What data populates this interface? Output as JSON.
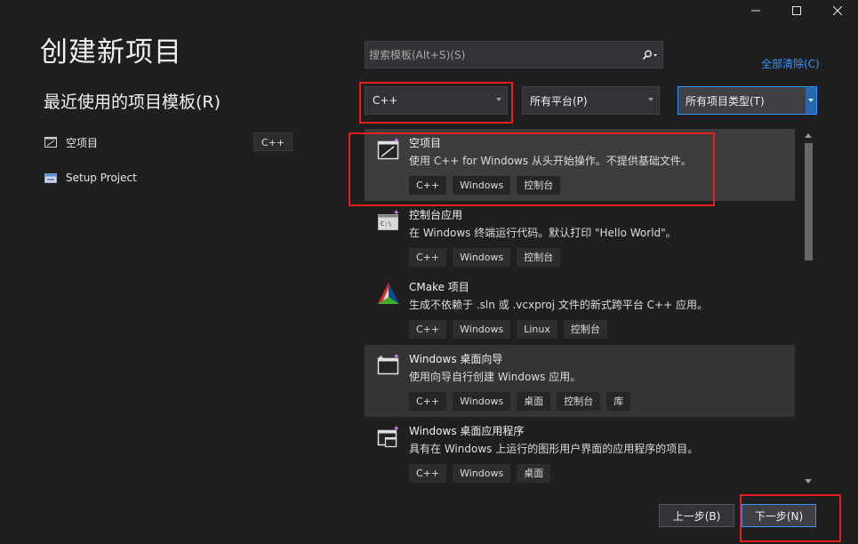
{
  "window": {
    "minimize_icon": "minimize-icon",
    "maximize_icon": "maximize-icon",
    "close_icon": "close-icon"
  },
  "page": {
    "title": "创建新项目"
  },
  "recent": {
    "title": "最近使用的项目模板(R)",
    "items": [
      {
        "label": "空项目",
        "tag": "C++",
        "icon": "empty-project-icon"
      },
      {
        "label": "Setup Project",
        "tag": "",
        "icon": "setup-project-icon"
      }
    ]
  },
  "search": {
    "placeholder": "搜索模板(Alt+S)(S)",
    "value": "",
    "icon": "search-icon"
  },
  "clear_all": "全部清除(C)",
  "filters": {
    "language": "C++",
    "platform": "所有平台(P)",
    "project_type": "所有项目类型(T)"
  },
  "templates": [
    {
      "name": "空项目",
      "description": "使用 C++ for Windows 从头开始操作。不提供基础文件。",
      "tags": [
        "C++",
        "Windows",
        "控制台"
      ],
      "icon": "empty-project-icon",
      "state": "selected"
    },
    {
      "name": "控制台应用",
      "description": "在 Windows 终端运行代码。默认打印 \"Hello World\"。",
      "tags": [
        "C++",
        "Windows",
        "控制台"
      ],
      "icon": "console-app-icon",
      "state": "normal"
    },
    {
      "name": "CMake 项目",
      "description": "生成不依赖于 .sln 或 .vcxproj 文件的新式跨平台 C++ 应用。",
      "tags": [
        "C++",
        "Windows",
        "Linux",
        "控制台"
      ],
      "icon": "cmake-icon",
      "state": "normal"
    },
    {
      "name": "Windows 桌面向导",
      "description": "使用向导自行创建 Windows 应用。",
      "tags": [
        "C++",
        "Windows",
        "桌面",
        "控制台",
        "库"
      ],
      "icon": "desktop-wizard-icon",
      "state": "hover"
    },
    {
      "name": "Windows 桌面应用程序",
      "description": "具有在 Windows 上运行的图形用户界面的应用程序的项目。",
      "tags": [
        "C++",
        "Windows",
        "桌面"
      ],
      "icon": "desktop-app-icon",
      "state": "normal"
    }
  ],
  "buttons": {
    "back": "上一步(B)",
    "next": "下一步(N)"
  },
  "colors": {
    "background": "#1f1f1f",
    "accent": "#3794ff",
    "highlight_box": "#e81e1e",
    "selected_row": "#3d3d3d"
  }
}
